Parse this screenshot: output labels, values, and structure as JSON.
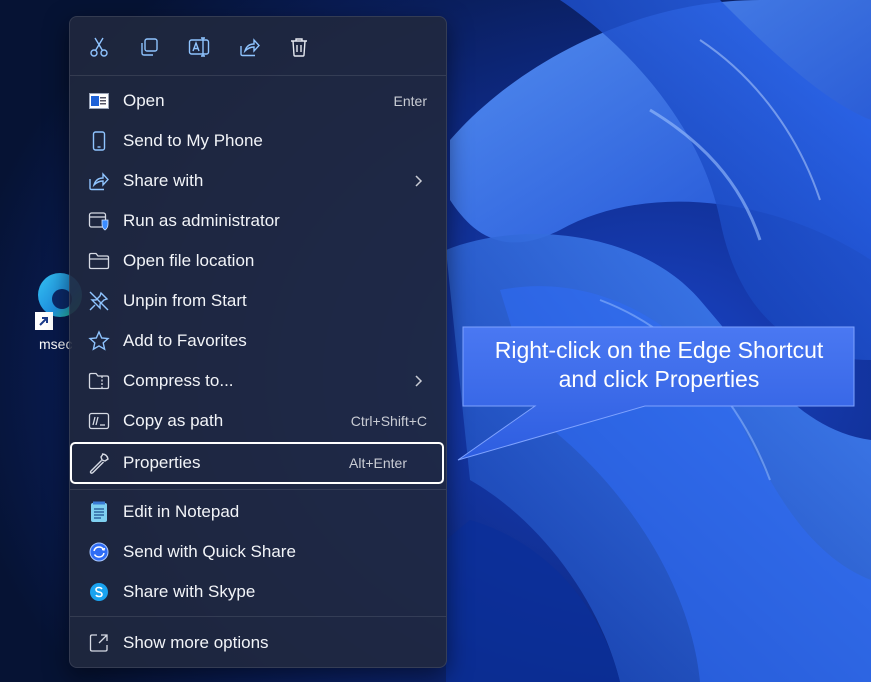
{
  "desktop": {
    "icon_label": "msec",
    "colors": {
      "accent": "#1f5fe8",
      "wallpaper_dark": "#0a1a44",
      "wallpaper_light": "#3a7dff"
    }
  },
  "context_menu": {
    "toolbar": [
      {
        "name": "cut-icon",
        "tooltip": "Cut"
      },
      {
        "name": "copy-icon",
        "tooltip": "Copy"
      },
      {
        "name": "rename-icon",
        "tooltip": "Rename"
      },
      {
        "name": "share-icon",
        "tooltip": "Share"
      },
      {
        "name": "delete-icon",
        "tooltip": "Delete"
      }
    ],
    "items": [
      {
        "label": "Open",
        "shortcut": "Enter",
        "icon": "open-icon"
      },
      {
        "label": "Send to My Phone",
        "shortcut": "",
        "icon": "phone-icon"
      },
      {
        "label": "Share with",
        "shortcut": "",
        "icon": "share-icon",
        "submenu": true
      },
      {
        "label": "Run as administrator",
        "shortcut": "",
        "icon": "admin-shield-icon"
      },
      {
        "label": "Open file location",
        "shortcut": "",
        "icon": "folder-icon"
      },
      {
        "label": "Unpin from Start",
        "shortcut": "",
        "icon": "unpin-icon"
      },
      {
        "label": "Add to Favorites",
        "shortcut": "",
        "icon": "star-icon"
      },
      {
        "label": "Compress to...",
        "shortcut": "",
        "icon": "zip-folder-icon",
        "submenu": true
      },
      {
        "label": "Copy as path",
        "shortcut": "Ctrl+Shift+C",
        "icon": "path-icon"
      },
      {
        "label": "Properties",
        "shortcut": "Alt+Enter",
        "icon": "wrench-icon",
        "highlighted": true
      },
      {
        "label": "Edit in Notepad",
        "shortcut": "",
        "icon": "notepad-icon"
      },
      {
        "label": "Send with Quick Share",
        "shortcut": "",
        "icon": "quick-share-icon"
      },
      {
        "label": "Share with Skype",
        "shortcut": "",
        "icon": "skype-icon"
      },
      {
        "label": "Show more options",
        "shortcut": "",
        "icon": "more-options-icon"
      }
    ]
  },
  "callout": {
    "line1": "Right-click on the Edge Shortcut",
    "line2": "and click Properties"
  }
}
